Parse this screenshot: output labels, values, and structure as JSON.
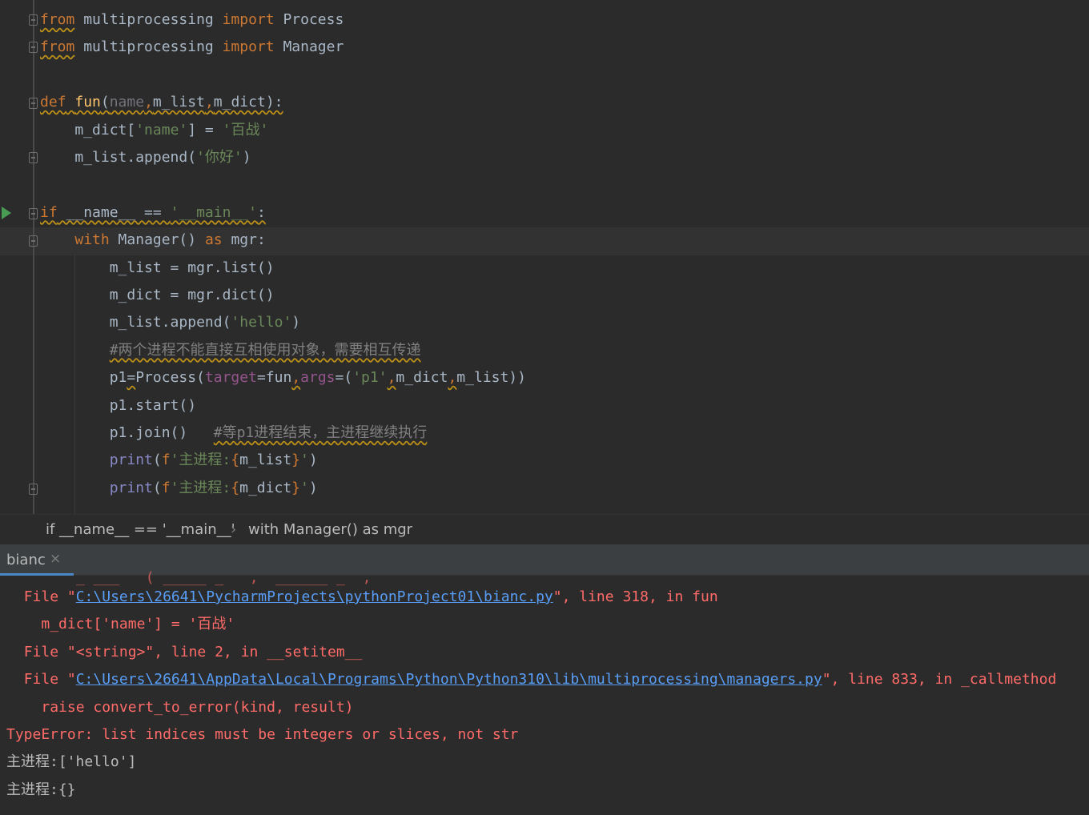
{
  "editor": {
    "lines": [
      {
        "parts": [
          [
            "kw warn",
            "from"
          ],
          [
            "",
            " multiprocessing "
          ],
          [
            "kw",
            "import"
          ],
          [
            "",
            " Process"
          ]
        ]
      },
      {
        "parts": [
          [
            "kw warn",
            "from"
          ],
          [
            "",
            " multiprocessing "
          ],
          [
            "kw",
            "import"
          ],
          [
            "",
            " Manager"
          ]
        ]
      },
      {
        "parts": []
      },
      {
        "parts": [
          [
            "kw warn",
            "def"
          ],
          [
            "warn",
            " "
          ],
          [
            "fn warn",
            "fun"
          ],
          [
            "warn",
            "("
          ],
          [
            "dim warn",
            "name"
          ],
          [
            "kw warn",
            ","
          ],
          [
            "warn",
            "m_list"
          ],
          [
            "kw warn",
            ","
          ],
          [
            "warn",
            "m_dict):"
          ]
        ]
      },
      {
        "parts": [
          [
            "",
            "    m_dict["
          ],
          [
            "str",
            "'name'"
          ],
          [
            "",
            "] = "
          ],
          [
            "str",
            "'百战'"
          ]
        ]
      },
      {
        "parts": [
          [
            "",
            "    m_list.append("
          ],
          [
            "str",
            "'你好'"
          ],
          [
            "",
            ")"
          ]
        ]
      },
      {
        "parts": []
      },
      {
        "parts": [
          [
            "kw warn",
            "if"
          ],
          [
            "warn",
            " __name__ == "
          ],
          [
            "str warn",
            "'__main__'"
          ],
          [
            "warn",
            ":"
          ]
        ]
      },
      {
        "parts": [
          [
            "",
            "    "
          ],
          [
            "kw",
            "with"
          ],
          [
            "",
            " Manager() "
          ],
          [
            "kw",
            "as"
          ],
          [
            "",
            " mgr:"
          ]
        ]
      },
      {
        "parts": [
          [
            "",
            "        m_list = mgr.list()"
          ]
        ]
      },
      {
        "parts": [
          [
            "",
            "        m_dict = mgr.dict()"
          ]
        ]
      },
      {
        "parts": [
          [
            "",
            "        m_list.append("
          ],
          [
            "str",
            "'hello'"
          ],
          [
            "",
            ")"
          ]
        ]
      },
      {
        "parts": [
          [
            "",
            "        "
          ],
          [
            "cmt warn",
            "#两个进程不能直接互相使用对象，需要相互传递"
          ]
        ]
      },
      {
        "parts": [
          [
            "",
            "        p1"
          ],
          [
            "err-wave",
            "="
          ],
          [
            "",
            "Process("
          ],
          [
            "param",
            "target"
          ],
          [
            "",
            "=fun"
          ],
          [
            "kw err-wave",
            ","
          ],
          [
            "param",
            "args"
          ],
          [
            "",
            "=("
          ],
          [
            "str",
            "'p1'"
          ],
          [
            "kw err-wave",
            ","
          ],
          [
            "",
            "m_dict"
          ],
          [
            "kw err-wave",
            ","
          ],
          [
            "",
            "m_list))"
          ]
        ]
      },
      {
        "parts": [
          [
            "",
            "        p1.start()"
          ]
        ]
      },
      {
        "parts": [
          [
            "",
            "        p1.join()   "
          ],
          [
            "cmt warn",
            "#等p1进程结束，主进程继续执行"
          ]
        ]
      },
      {
        "parts": [
          [
            "",
            "        "
          ],
          [
            "builtin",
            "print"
          ],
          [
            "",
            "("
          ],
          [
            "kw",
            "f"
          ],
          [
            "str",
            "'主进程:"
          ],
          [
            "kw",
            "{"
          ],
          [
            "",
            "m_list"
          ],
          [
            "kw",
            "}"
          ],
          [
            "str",
            "'"
          ],
          [
            "",
            ")"
          ]
        ]
      },
      {
        "parts": [
          [
            "",
            "        "
          ],
          [
            "builtin",
            "print"
          ],
          [
            "",
            "("
          ],
          [
            "kw",
            "f"
          ],
          [
            "str",
            "'主进程:"
          ],
          [
            "kw",
            "{"
          ],
          [
            "",
            "m_dict"
          ],
          [
            "kw",
            "}"
          ],
          [
            "str",
            "'"
          ],
          [
            "",
            ")"
          ]
        ]
      }
    ]
  },
  "breadcrumb": {
    "item1": "if __name__ == '__main__'",
    "separator": "›",
    "item2": "with Manager() as mgr"
  },
  "run_panel": {
    "tab_label": "bianc",
    "close_glyph": "×"
  },
  "console": {
    "clipped_top": "_ ___   ( _____ _   ,  ______ _  ,",
    "lines": [
      {
        "indent": "  ",
        "parts": [
          [
            "",
            "File \""
          ],
          [
            "link",
            "C:\\Users\\26641\\PycharmProjects\\pythonProject01\\bianc.py"
          ],
          [
            "",
            "\", line 318, in fun"
          ]
        ]
      },
      {
        "indent": "    ",
        "parts": [
          [
            "",
            "m_dict['name'] = '百战'"
          ]
        ]
      },
      {
        "indent": "  ",
        "parts": [
          [
            "",
            "File \"<string>\", line 2, in __setitem__"
          ]
        ]
      },
      {
        "indent": "  ",
        "parts": [
          [
            "",
            "File \""
          ],
          [
            "link",
            "C:\\Users\\26641\\AppData\\Local\\Programs\\Python\\Python310\\lib\\multiprocessing\\managers.py"
          ],
          [
            "",
            "\", line 833, in _callmethod"
          ]
        ]
      },
      {
        "indent": "    ",
        "parts": [
          [
            "",
            "raise convert_to_error(kind, result)"
          ]
        ]
      },
      {
        "indent": "",
        "parts": [
          [
            "",
            "TypeError: list indices must be integers or slices, not str"
          ]
        ]
      },
      {
        "indent": "",
        "normal": true,
        "parts": [
          [
            "",
            "主进程:['hello']"
          ]
        ]
      },
      {
        "indent": "",
        "normal": true,
        "parts": [
          [
            "",
            "主进程:{}"
          ]
        ]
      }
    ]
  }
}
